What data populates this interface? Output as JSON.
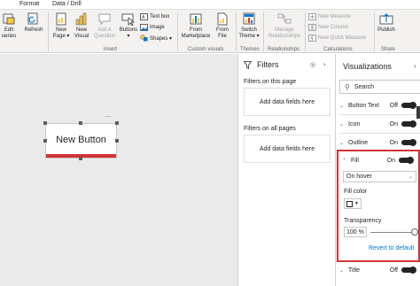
{
  "tabs": {
    "format": "Format",
    "data_drill": "Data / Drill"
  },
  "ribbon": {
    "edit_queries": "Edit\nueries",
    "edit_queries_caret": "▾",
    "refresh": "Refresh",
    "new_page": "New\nPage ▾",
    "new_visual": "New\nVisual",
    "ask_question": "Ask A\nQuestion",
    "buttons": "Buttons\n▾",
    "text_box": "Text box",
    "image": "Image",
    "shapes": "Shapes ▾",
    "insert_group": "Insert",
    "from_marketplace": "From\nMarketplace",
    "from_file": "From\nFile",
    "custom_visuals_group": "Custom visuals",
    "switch_theme": "Switch\nTheme ▾",
    "themes_group": "Themes",
    "manage_relationships": "Manage\nRelationships",
    "relationships_group": "Relationships",
    "new_measure": "New Measure",
    "new_column": "New Column",
    "new_quick_measure": "New Quick Measure",
    "calculations_group": "Calculations",
    "publish": "Publish",
    "share_group": "Share"
  },
  "canvas": {
    "button_label": "New Button",
    "more_options": "···"
  },
  "filters": {
    "title": "Filters",
    "eye_icon": "◎",
    "collapse_icon": "›",
    "on_page_label": "Filters on this page",
    "on_page_well": "Add data fields here",
    "on_all_label": "Filters on all pages",
    "on_all_well": "Add data fields here"
  },
  "visualizations": {
    "title": "Visualizations",
    "collapse_icon": "›",
    "search_placeholder": "Search",
    "rows": [
      {
        "name": "Button Text",
        "state": "Off"
      },
      {
        "name": "Icon",
        "state": "On"
      },
      {
        "name": "Outline",
        "state": "On"
      }
    ],
    "fill": {
      "name": "Fill",
      "state": "On",
      "dropdown_value": "On hover",
      "fill_color_label": "Fill color",
      "transparency_label": "Transparency",
      "transparency_value": "100 %",
      "transparency_level": 100,
      "revert_label": "Revert to default"
    },
    "title_row": {
      "name": "Title",
      "state": "Off"
    }
  },
  "colors": {
    "accent_red": "#d13438",
    "link_blue": "#0078d4",
    "ribbon_bg": "#f3f2f1"
  }
}
